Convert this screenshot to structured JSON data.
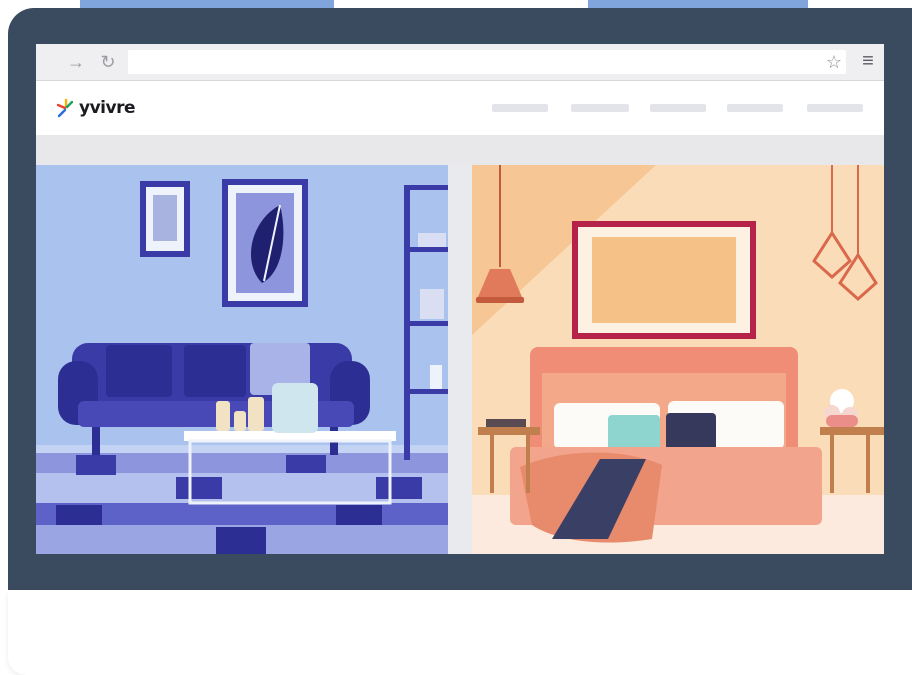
{
  "site": {
    "logo_text": "yvivre"
  },
  "browser": {
    "back_icon": "arrow-right-icon",
    "reload_icon": "reload-icon",
    "bookmark_icon": "star-icon",
    "menu_icon": "hamburger-menu-icon"
  },
  "icons": {
    "back": "→",
    "reload": "↻",
    "star": "☆",
    "menu": "≡"
  },
  "colors": {
    "monitor": "#3a4a5f",
    "living_room_wall": "#a9c3ee",
    "living_room_accent": "#3a3ba6",
    "bedroom_wall": "#f6c794",
    "bedroom_accent": "#b5234a"
  }
}
